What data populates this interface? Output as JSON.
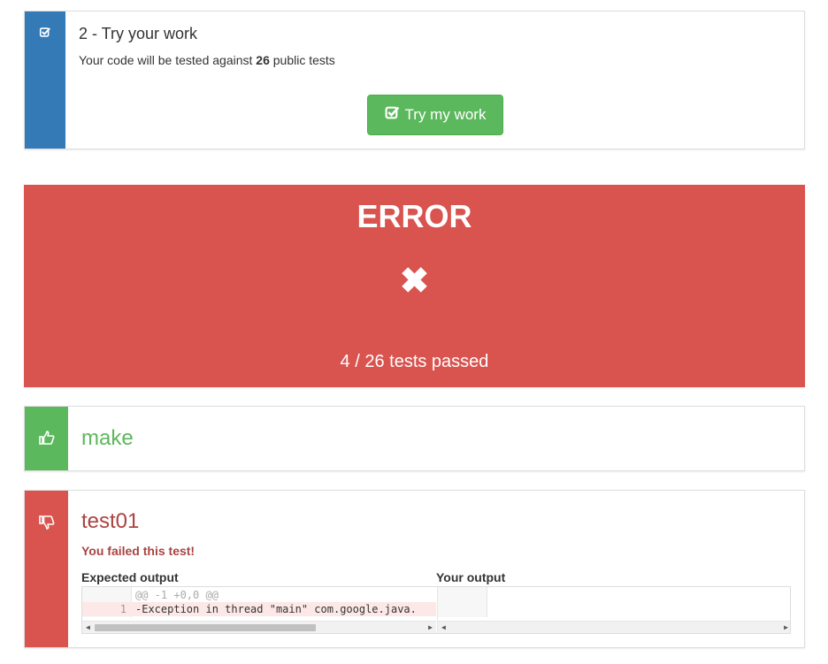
{
  "try_section": {
    "icon": "check-square-icon",
    "title": "2 - Try your work",
    "desc_prefix": "Your code will be tested against ",
    "test_count": "26",
    "desc_suffix": " public tests",
    "button_label": "Try my work",
    "accent": "#337ab7",
    "button_color": "#5cb85c"
  },
  "result": {
    "status": "ERROR",
    "status_icon": "✖",
    "summary": "4 / 26 tests passed",
    "color": "#d9534f"
  },
  "tests": [
    {
      "name": "make",
      "icon": "thumbs-up-icon",
      "color": "#5cb85c"
    },
    {
      "name": "test01",
      "icon": "thumbs-down-icon",
      "color": "#d9534f",
      "message": "You failed this test!",
      "expected_label": "Expected output",
      "yours_label": "Your output",
      "diff_hunk": "@@ -1 +0,0 @@",
      "diff_line_no": "1",
      "diff_line": "-Exception in thread \"main\" com.google.java."
    }
  ]
}
